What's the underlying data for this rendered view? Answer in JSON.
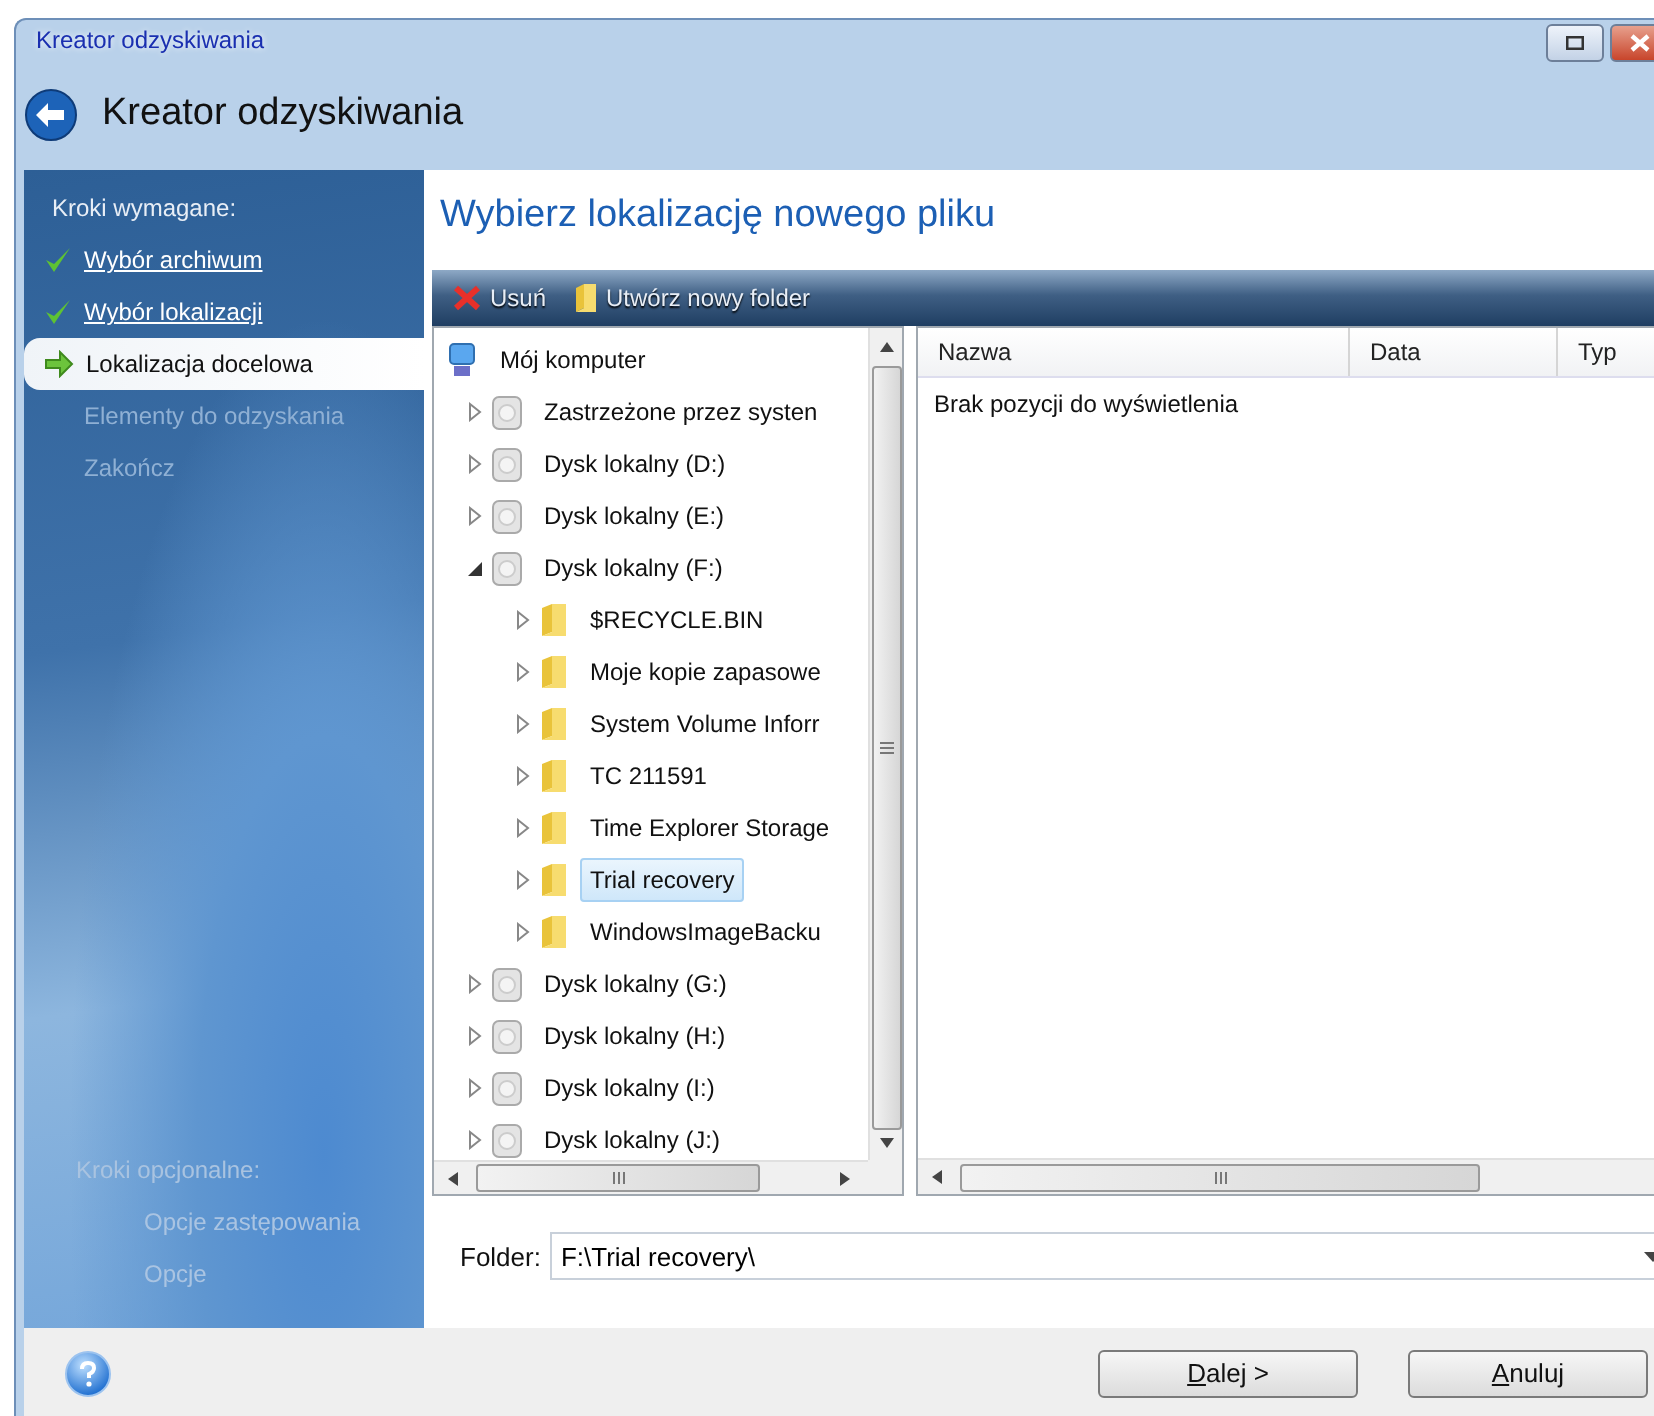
{
  "window": {
    "title": "Kreator odzyskiwania",
    "heading": "Kreator odzyskiwania"
  },
  "sidebar": {
    "required_title": "Kroki wymagane:",
    "required_steps": [
      {
        "label": "Wybór archiwum",
        "completed": true,
        "selected": false
      },
      {
        "label": "Wybór lokalizacji",
        "completed": true,
        "selected": false
      },
      {
        "label": "Lokalizacja docelowa",
        "completed": false,
        "selected": true
      },
      {
        "label": "Elementy do odzyskania",
        "completed": false,
        "selected": false
      },
      {
        "label": "Zakończ",
        "completed": false,
        "selected": false
      }
    ],
    "optional_title": "Kroki opcjonalne:",
    "optional_steps": [
      {
        "label": "Opcje zastępowania",
        "completed": false,
        "selected": false
      },
      {
        "label": "Opcje",
        "completed": false,
        "selected": false
      }
    ]
  },
  "page_title": "Wybierz lokalizację nowego pliku",
  "toolbar": [
    {
      "label": "Usuń",
      "kind": "delete"
    },
    {
      "label": "Utwórz nowy folder",
      "kind": "folder"
    }
  ],
  "tree": {
    "root": {
      "label": "Mój komputer",
      "kind": "computer",
      "selected": false,
      "children": [
        {
          "label": "Zastrzeżone przez systen",
          "kind": "drive",
          "expanded": false,
          "selected": false
        },
        {
          "label": "Dysk lokalny (D:)",
          "kind": "drive",
          "expanded": false,
          "selected": false
        },
        {
          "label": "Dysk lokalny (E:)",
          "kind": "drive",
          "expanded": false,
          "selected": false
        },
        {
          "label": "Dysk lokalny (F:)",
          "kind": "drive",
          "expanded": true,
          "selected": false,
          "children": [
            {
              "label": "$RECYCLE.BIN",
              "kind": "folder",
              "expanded": false,
              "selected": false
            },
            {
              "label": "Moje kopie zapasowe",
              "kind": "folder",
              "expanded": false,
              "selected": false
            },
            {
              "label": "System Volume Inforr",
              "kind": "folder",
              "expanded": false,
              "selected": false
            },
            {
              "label": "TC 211591",
              "kind": "folder",
              "expanded": false,
              "selected": false
            },
            {
              "label": "Time Explorer Storage",
              "kind": "folder",
              "expanded": false,
              "selected": false
            },
            {
              "label": "Trial recovery",
              "kind": "folder",
              "expanded": false,
              "selected": true
            },
            {
              "label": "WindowsImageBacku",
              "kind": "folder",
              "expanded": false,
              "selected": false
            }
          ]
        },
        {
          "label": "Dysk lokalny (G:)",
          "kind": "drive",
          "expanded": false,
          "selected": false
        },
        {
          "label": "Dysk lokalny (H:)",
          "kind": "drive",
          "expanded": false,
          "selected": false
        },
        {
          "label": "Dysk lokalny (I:)",
          "kind": "drive",
          "expanded": false,
          "selected": false
        },
        {
          "label": "Dysk lokalny (J:)",
          "kind": "drive",
          "expanded": false,
          "selected": false
        }
      ]
    }
  },
  "list": {
    "columns": [
      "Nazwa",
      "Data",
      "Typ"
    ],
    "empty_message": "Brak pozycji do wyświetlenia"
  },
  "folder": {
    "label": "Folder:",
    "value": "F:\\Trial recovery\\"
  },
  "buttons": [
    {
      "label": "Dalej >"
    },
    {
      "label": "Anuluj"
    }
  ]
}
